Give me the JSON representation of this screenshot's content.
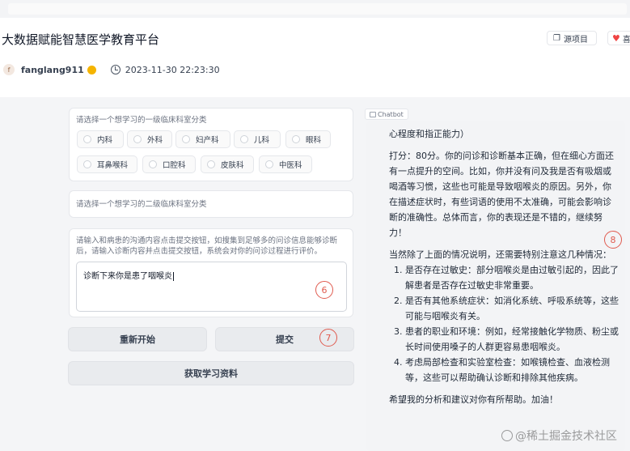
{
  "header": {
    "title": "大数据赋能智慧医学教育平台",
    "source_button": "源项目",
    "like_button": "喜",
    "username": "fanglang911",
    "avatar_letter": "f",
    "timestamp": "2023-11-30 22:23:30"
  },
  "level1": {
    "label": "请选择一个想学习的一级临床科室分类",
    "options": [
      "内科",
      "外科",
      "妇产科",
      "儿科",
      "眼科",
      "耳鼻喉科",
      "口腔科",
      "皮肤科",
      "中医科"
    ]
  },
  "level2": {
    "label": "请选择一个想学习的二级临床科室分类"
  },
  "dialog": {
    "instructions": "请输入和病患的沟通内容点击提交按钮，如搜集到足够多的问诊信息能够诊断后，请输入诊断内容并点击提交按钮，系统会对你的问诊过程进行评价。",
    "input_value": "诊断下来你是患了咽喉炎"
  },
  "buttons": {
    "restart": "重新开始",
    "submit": "提交",
    "get_materials": "获取学习资料"
  },
  "annotations": {
    "input_marker": "6",
    "submit_marker": "7",
    "chat_marker": "8"
  },
  "chatbot": {
    "tab_label": "Chatbot",
    "line0": "心程度和指正能力）",
    "score_paragraph": "打分：80分。你的问诊和诊断基本正确，但在细心方面还有一点提升的空间。比如，你并没有问及我是否有吸烟或喝酒等习惯，这些也可能是导致咽喉炎的原因。另外，你在描述症状时，有些词语的使用不太准确，可能会影响诊断的准确性。总体而言，你的表现还是不错的，继续努力！",
    "intro": "当然除了上面的情况说明，还需要特别注意这几种情况：",
    "items": [
      "是否存在过敏史：部分咽喉炎是由过敏引起的，因此了解患者是否存在过敏史非常重要。",
      "是否有其他系统症状：如消化系统、呼吸系统等，这些可能与咽喉炎有关。",
      "患者的职业和环境：例如，经常接触化学物质、粉尘或长时间使用嗓子的人群更容易患咽喉炎。",
      "考虑局部检查和实验室检查：如喉镜检查、血液检测等，这些可以帮助确认诊断和排除其他疾病。"
    ],
    "closing": "希望我的分析和建议对你有所帮助。加油！"
  },
  "watermark": "@稀土掘金技术社区"
}
